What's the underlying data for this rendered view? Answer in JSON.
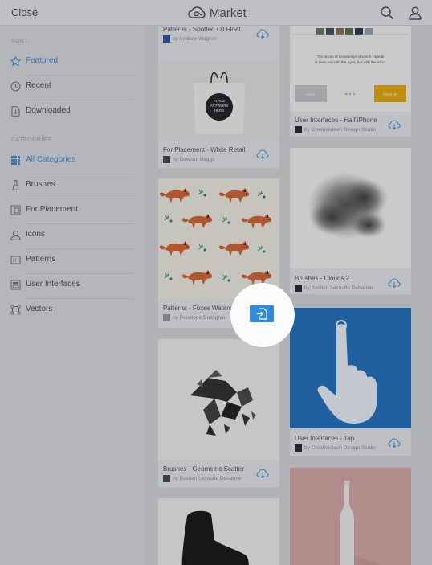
{
  "header": {
    "close_label": "Close",
    "app_title": "Market",
    "logo_icon": "creative-cloud-icon",
    "search_icon": "search-icon",
    "user_icon": "user-icon"
  },
  "sidebar": {
    "sort_label": "SORT",
    "sort_items": [
      {
        "label": "Featured",
        "icon": "star-icon",
        "active": true
      },
      {
        "label": "Recent",
        "icon": "clock-icon",
        "active": false
      },
      {
        "label": "Downloaded",
        "icon": "download-file-icon",
        "active": false
      }
    ],
    "categories_label": "CATEGORIES",
    "category_items": [
      {
        "label": "All Categories",
        "icon": "grid-icon",
        "active": true
      },
      {
        "label": "Brushes",
        "icon": "brush-icon",
        "active": false
      },
      {
        "label": "For Placement",
        "icon": "placement-icon",
        "active": false
      },
      {
        "label": "Icons",
        "icon": "icons-icon",
        "active": false
      },
      {
        "label": "Patterns",
        "icon": "pattern-icon",
        "active": false
      },
      {
        "label": "User Interfaces",
        "icon": "ui-icon",
        "active": false
      },
      {
        "label": "Vectors",
        "icon": "vector-icon",
        "active": false
      }
    ]
  },
  "cards": {
    "oil_float": {
      "title": "Patterns - Spotted Oil Float",
      "author": "by Andrew Wagner"
    },
    "white_retail": {
      "title": "For Placement - White Retail",
      "author": "by Dawson Beggs",
      "tag_lines": [
        "PLACE",
        "ARTWORK",
        "HERE"
      ]
    },
    "foxes": {
      "title": "Patterns - Foxes Watercolor",
      "author": "by Penelope Dullaghan"
    },
    "geo_scatter": {
      "title": "Brushes - Geometric Scatter",
      "author": "by Bastien Lecouffe Deharme"
    },
    "half_iphone": {
      "title": "User Interfaces - Half iPhone",
      "author": "by Creativedash Design Studio",
      "quote_lines": [
        "The vision of knowledge of which I speak",
        "is seen not with the eyes, but with the mind."
      ],
      "left_button": "SKIP",
      "right_button": "SIGN UP"
    },
    "clouds": {
      "title": "Brushes - Clouds 2",
      "author": "by Bastien Lecouffe Deharme"
    },
    "tap": {
      "title": "User Interfaces - Tap",
      "author": "by Creativedash Design Studio"
    }
  },
  "colors": {
    "accent": "#3d8fe0",
    "place_button": "#2e8be0",
    "tap_bg": "#1f6fbf",
    "signup_button": "#e8a90a",
    "bottle_bg": "#d9a7a3"
  },
  "place_action_icon": "place-file-icon",
  "download_icon": "cloud-download-icon"
}
